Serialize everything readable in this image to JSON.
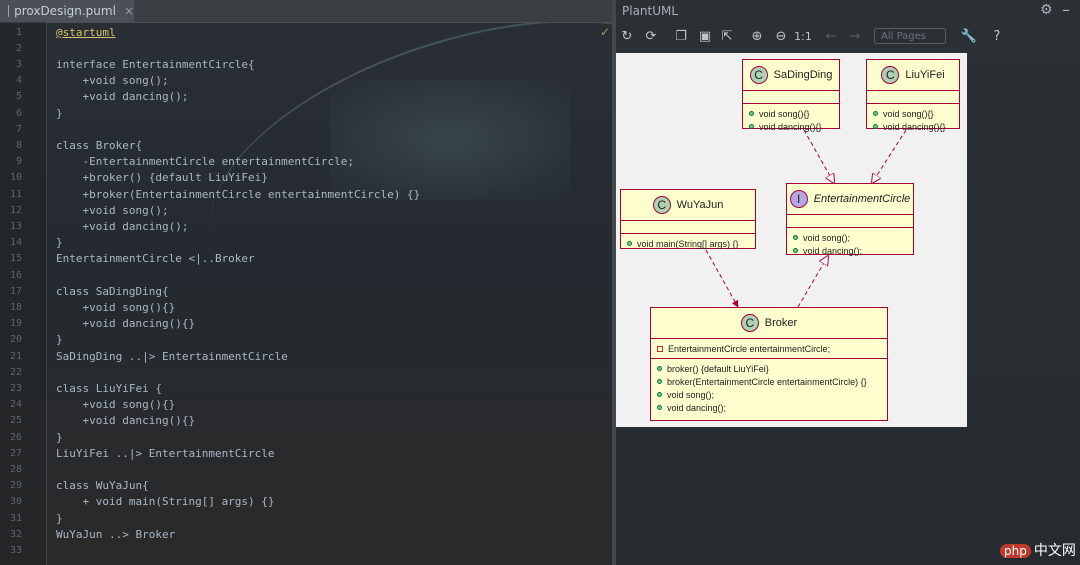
{
  "editor": {
    "tab_label": "prox‍Design.puml",
    "tab_close": "×",
    "lines": [
      {
        "n": "1",
        "t": "@startuml"
      },
      {
        "n": "2",
        "t": ""
      },
      {
        "n": "3",
        "t": "interface EntertainmentCircle{"
      },
      {
        "n": "4",
        "t": "    +void song();"
      },
      {
        "n": "5",
        "t": "    +void dancing();"
      },
      {
        "n": "6",
        "t": "}"
      },
      {
        "n": "7",
        "t": ""
      },
      {
        "n": "8",
        "t": "class Broker{"
      },
      {
        "n": "9",
        "t": "    -EntertainmentCircle entertainmentCircle;"
      },
      {
        "n": "10",
        "t": "    +broker() {default LiuYiFei}"
      },
      {
        "n": "11",
        "t": "    +broker(EntertainmentCircle entertainmentCircle) {}"
      },
      {
        "n": "12",
        "t": "    +void song();"
      },
      {
        "n": "13",
        "t": "    +void dancing();"
      },
      {
        "n": "14",
        "t": "}"
      },
      {
        "n": "15",
        "t": "EntertainmentCircle <|..Broker"
      },
      {
        "n": "16",
        "t": ""
      },
      {
        "n": "17",
        "t": "class SaDingDing{"
      },
      {
        "n": "18",
        "t": "    +void song(){}"
      },
      {
        "n": "19",
        "t": "    +void dancing(){}"
      },
      {
        "n": "20",
        "t": "}"
      },
      {
        "n": "21",
        "t": "SaDingDing ..|> EntertainmentCircle"
      },
      {
        "n": "22",
        "t": ""
      },
      {
        "n": "23",
        "t": "class LiuYiFei {"
      },
      {
        "n": "24",
        "t": "    +void song(){}"
      },
      {
        "n": "25",
        "t": "    +void dancing(){}"
      },
      {
        "n": "26",
        "t": "}"
      },
      {
        "n": "27",
        "t": "LiuYiFei ..|> EntertainmentCircle"
      },
      {
        "n": "28",
        "t": ""
      },
      {
        "n": "29",
        "t": "class WuYaJun{"
      },
      {
        "n": "30",
        "t": "    + void main(String[] args) {}"
      },
      {
        "n": "31",
        "t": "}"
      },
      {
        "n": "32",
        "t": "WuYaJun ..> Broker"
      },
      {
        "n": "33",
        "t": ""
      }
    ]
  },
  "plantuml": {
    "title": "PlantUML",
    "page_selector": "All Pages",
    "toolbar_zoom_label": "1:1",
    "classes": {
      "sadingding": {
        "stereo": "C",
        "name": "SaDingDing",
        "methods": [
          "void song(){}",
          "void dancing(){}"
        ]
      },
      "liuyifei": {
        "stereo": "C",
        "name": "LiuYiFei",
        "methods": [
          "void song(){}",
          "void dancing(){}"
        ]
      },
      "wuyajun": {
        "stereo": "C",
        "name": "WuYaJun",
        "methods": [
          "void main(String[] args) {}"
        ]
      },
      "entertainment": {
        "stereo": "I",
        "name": "EntertainmentCircle",
        "methods": [
          "void song();",
          "void dancing();"
        ]
      },
      "broker": {
        "stereo": "C",
        "name": "Broker",
        "fields": [
          "EntertainmentCircle entertainmentCircle;"
        ],
        "methods": [
          "broker() {default LiuYiFei}",
          "broker(EntertainmentCircle entertainmentCircle) {}",
          "void song();",
          "void dancing();"
        ]
      }
    }
  },
  "watermark": {
    "badge": "php",
    "text": "中文网"
  }
}
